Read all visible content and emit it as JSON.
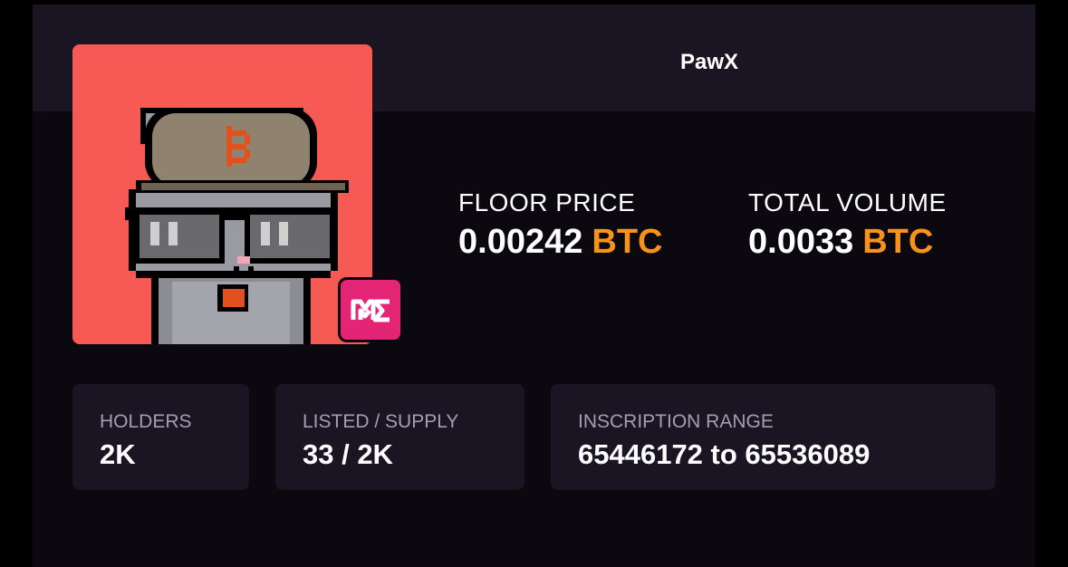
{
  "collection": {
    "name": "PawX"
  },
  "image": {
    "background_color": "#f75a55",
    "subject": "pixel-art grey cat with bitcoin helmet and sunglasses"
  },
  "badge": {
    "icon": "magic-eden-logo",
    "color": "#e42575"
  },
  "stats": {
    "floor_price": {
      "label": "FLOOR PRICE",
      "value": "0.00242",
      "currency": "BTC"
    },
    "total_volume": {
      "label": "TOTAL VOLUME",
      "value": "0.0033",
      "currency": "BTC"
    }
  },
  "info_boxes": {
    "holders": {
      "label": "HOLDERS",
      "value": "2K"
    },
    "listed_supply": {
      "label": "LISTED / SUPPLY",
      "value": "33 / 2K"
    },
    "inscription_range": {
      "label": "INSCRIPTION RANGE",
      "value": "65446172 to 65536089"
    }
  },
  "colors": {
    "accent": "#f7931a",
    "panel": "#1b1523",
    "background": "#0b090f"
  }
}
